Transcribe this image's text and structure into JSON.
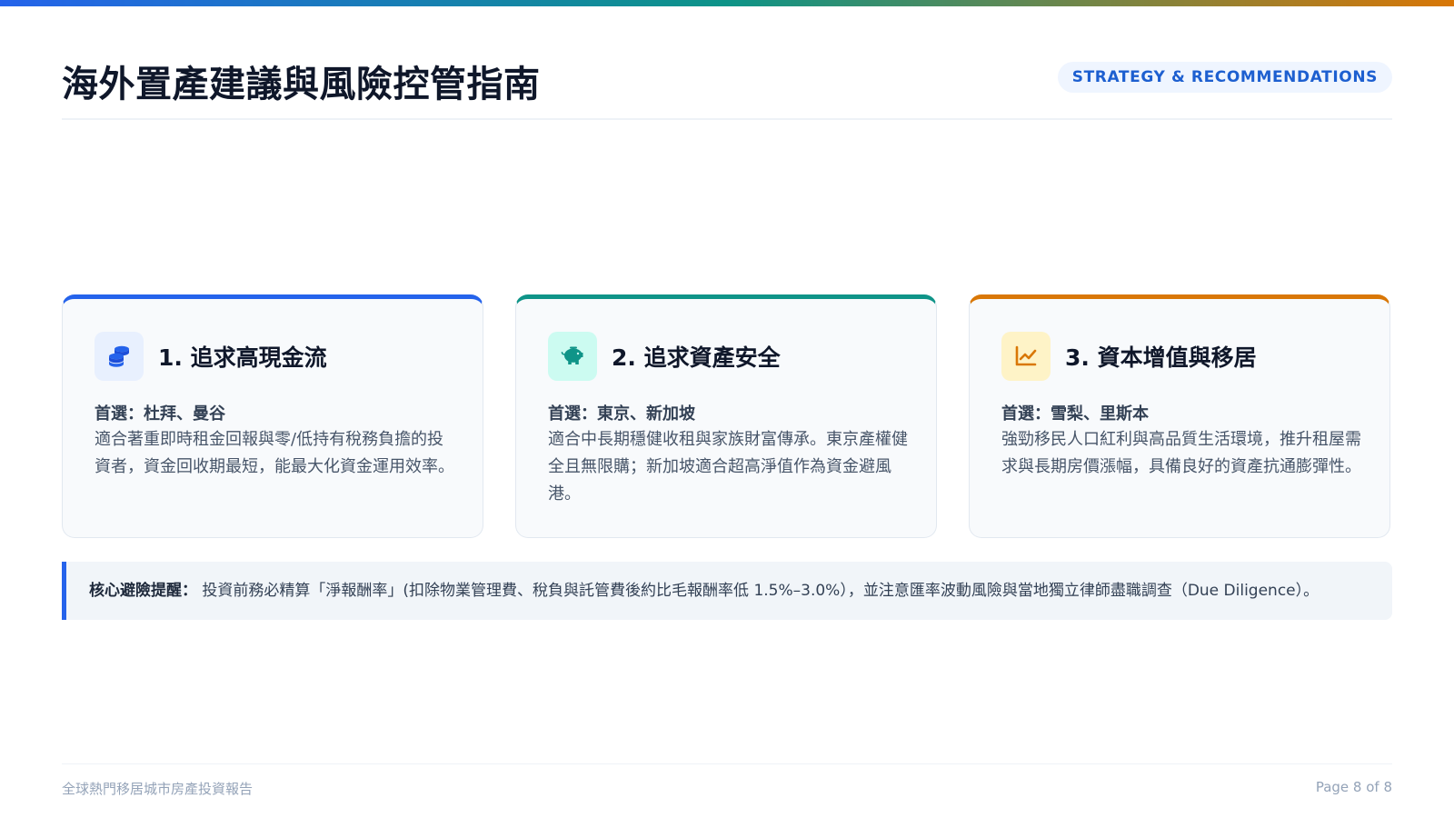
{
  "header": {
    "title": "海外置產建議與風險控管指南",
    "badge": "STRATEGY & RECOMMENDATIONS"
  },
  "cards": [
    {
      "icon": "coins-icon",
      "accent": "#2563eb",
      "title": "1. 追求高現金流",
      "pick": "首選：杜拜、曼谷",
      "description": "適合著重即時租金回報與零/低持有稅務負擔的投資者，資金回收期最短，能最大化資金運用效率。"
    },
    {
      "icon": "piggy-bank-icon",
      "accent": "#0f9488",
      "title": "2. 追求資產安全",
      "pick": "首選：東京、新加坡",
      "description": "適合中長期穩健收租與家族財富傳承。東京產權健全且無限購；新加坡適合超高淨值作為資金避風港。"
    },
    {
      "icon": "chart-line-icon",
      "accent": "#d97706",
      "title": "3. 資本增值與移居",
      "pick": "首選：雪梨、里斯本",
      "description": "強勁移民人口紅利與高品質生活環境，推升租屋需求與長期房價漲幅，具備良好的資產抗通膨彈性。"
    }
  ],
  "alert": {
    "label": "核心避險提醒：",
    "text": "投資前務必精算「淨報酬率」(扣除物業管理費、稅負與託管費後約比毛報酬率低 1.5%–3.0%），並注意匯率波動風險與當地獨立律師盡職調查（Due Diligence）。"
  },
  "footer": {
    "left": "全球熱門移居城市房產投資報告",
    "right": "Page 8 of 8"
  }
}
